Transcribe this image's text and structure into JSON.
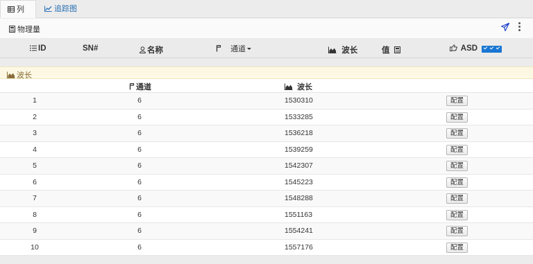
{
  "tabs": [
    {
      "label": "列表",
      "icon": "table-icon",
      "active": true
    },
    {
      "label": "追踪图",
      "icon": "line-chart-icon",
      "active": false
    }
  ],
  "toolbar": {
    "title": "物理量",
    "title_icon": "calculator-icon",
    "actions": [
      "send-icon",
      "kebab-menu-icon"
    ]
  },
  "header": {
    "id": "ID",
    "sn": "SN#",
    "name": "名称",
    "channel": "通道",
    "wavelength": "波长",
    "value": "值",
    "asd": "ASD"
  },
  "group": {
    "label": "波长"
  },
  "subheader": {
    "channel": "通道",
    "wavelength": "波长"
  },
  "rows": [
    {
      "index": "1",
      "channel": "6",
      "wavelength": "1530310",
      "action": "配置"
    },
    {
      "index": "2",
      "channel": "6",
      "wavelength": "1533285",
      "action": "配置"
    },
    {
      "index": "3",
      "channel": "6",
      "wavelength": "1536218",
      "action": "配置"
    },
    {
      "index": "4",
      "channel": "6",
      "wavelength": "1539259",
      "action": "配置"
    },
    {
      "index": "5",
      "channel": "6",
      "wavelength": "1542307",
      "action": "配置"
    },
    {
      "index": "6",
      "channel": "6",
      "wavelength": "1545223",
      "action": "配置"
    },
    {
      "index": "7",
      "channel": "6",
      "wavelength": "1548288",
      "action": "配置"
    },
    {
      "index": "8",
      "channel": "6",
      "wavelength": "1551163",
      "action": "配置"
    },
    {
      "index": "9",
      "channel": "6",
      "wavelength": "1554241",
      "action": "配置"
    },
    {
      "index": "10",
      "channel": "6",
      "wavelength": "1557176",
      "action": "配置"
    }
  ],
  "colors": {
    "accent": "#1976d2",
    "link": "#2a72b5",
    "group_bg": "#fcf8e3",
    "group_text": "#8a6d3b"
  }
}
